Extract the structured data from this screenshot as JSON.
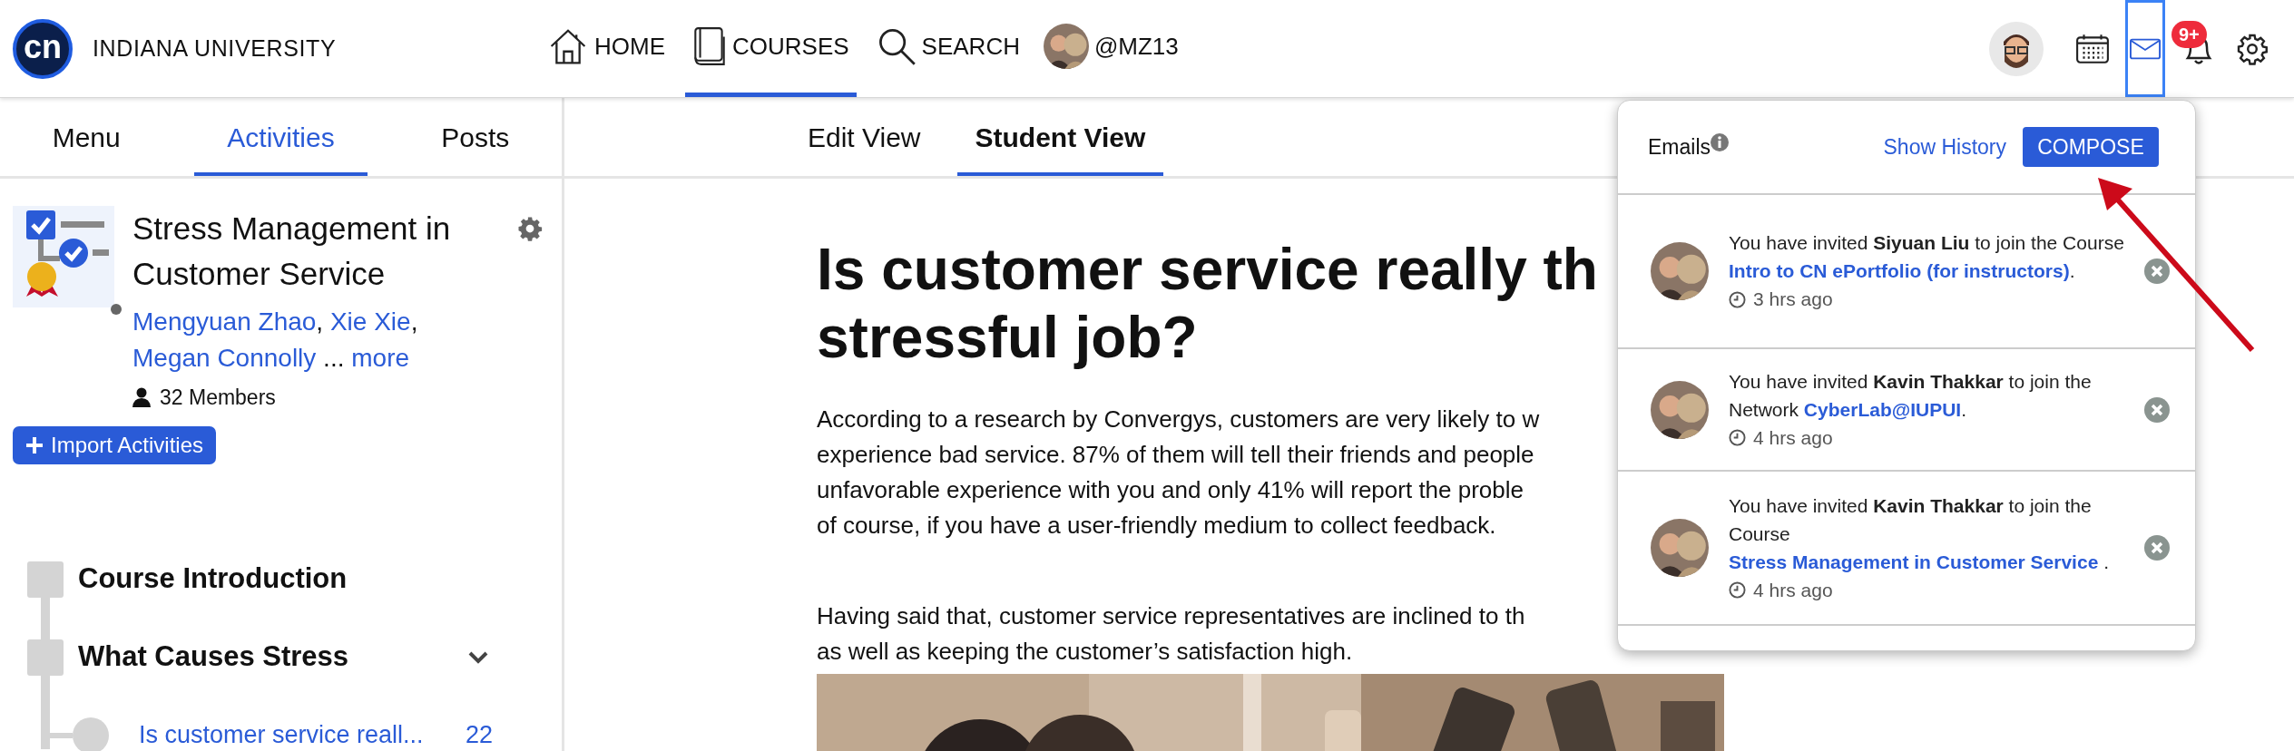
{
  "brand": {
    "logo_text": "cn",
    "name": "INDIANA UNIVERSITY"
  },
  "nav": [
    {
      "kind": "home",
      "label": "HOME",
      "selected": false
    },
    {
      "kind": "book",
      "label": "COURSES",
      "selected": true
    },
    {
      "kind": "search",
      "label": "SEARCH",
      "selected": false
    },
    {
      "kind": "user",
      "label": "@MZ13",
      "selected": false
    }
  ],
  "toolbar": [
    {
      "kind": "avatar",
      "selected": false
    },
    {
      "kind": "calendar",
      "selected": false
    },
    {
      "kind": "mail",
      "selected": true
    },
    {
      "kind": "bell",
      "selected": false,
      "badge": "9+"
    },
    {
      "kind": "settings",
      "selected": false
    }
  ],
  "sidebar": {
    "tabs": [
      {
        "label": "Menu",
        "selected": false
      },
      {
        "label": "Activities",
        "selected": true
      },
      {
        "label": "Posts",
        "selected": false
      }
    ],
    "course": {
      "title": "Stress Management in Customer Service",
      "authors": [
        {
          "text": "Mengyuan Zhao",
          "after": ", "
        },
        {
          "text": "Xie Xie",
          "after": ", "
        },
        {
          "text": "Megan Connolly",
          "after": " ... "
        },
        {
          "text": "more"
        }
      ],
      "members": "32 Members",
      "import_button": "Import Activities"
    },
    "tree": [
      {
        "title": "Course Introduction",
        "expanded": false
      },
      {
        "title": "What Causes Stress",
        "expanded": true,
        "children": [
          {
            "title": "Is customer service reall...",
            "count": "22"
          }
        ]
      }
    ]
  },
  "main": {
    "tabs": [
      {
        "label": "Edit View",
        "selected": false
      },
      {
        "label": "Student View",
        "selected": true
      }
    ],
    "heading_lines": [
      "Is customer service really th",
      "stressful job?"
    ],
    "paragraphs": [
      [
        "According to a research by Convergys, customers are very likely to w",
        "experience bad service. 87% of them will tell their friends and people",
        "unfavorable experience with you and only 41% will report the proble",
        "of course, if you have a user-friendly medium to collect feedback."
      ],
      [
        "Having said that, customer service representatives are inclined to th",
        "as well as keeping the customer’s satisfaction high."
      ]
    ],
    "image": {
      "kind": "picture"
    }
  },
  "email_popup": {
    "title": "Emails",
    "show_history": "Show History",
    "compose": "COMPOSE",
    "items": [
      {
        "parts": [
          {
            "text": "You have invited ",
            "kind": "plain"
          },
          {
            "text": "Siyuan Liu",
            "kind": "bold"
          },
          {
            "text": " to join the Course ",
            "kind": "plain"
          },
          {
            "text": "Intro to CN ePortfolio (for instructors)",
            "kind": "link"
          },
          {
            "text": ".",
            "kind": "plain"
          }
        ],
        "time": "3 hrs ago"
      },
      {
        "parts": [
          {
            "text": "You have invited ",
            "kind": "plain"
          },
          {
            "text": "Kavin Thakkar",
            "kind": "bold"
          },
          {
            "text": " to join the Network ",
            "kind": "plain"
          },
          {
            "text": "CyberLab@IUPUI",
            "kind": "link"
          },
          {
            "text": ".",
            "kind": "plain"
          }
        ],
        "time": "4 hrs ago"
      },
      {
        "parts": [
          {
            "text": "You have invited ",
            "kind": "plain"
          },
          {
            "text": "Kavin Thakkar",
            "kind": "bold"
          },
          {
            "text": " to join the Course ",
            "kind": "plain"
          },
          {
            "text": "Stress Management in Customer Service",
            "kind": "link"
          },
          {
            "text": " .",
            "kind": "plain"
          }
        ],
        "time": "4 hrs ago"
      }
    ]
  }
}
